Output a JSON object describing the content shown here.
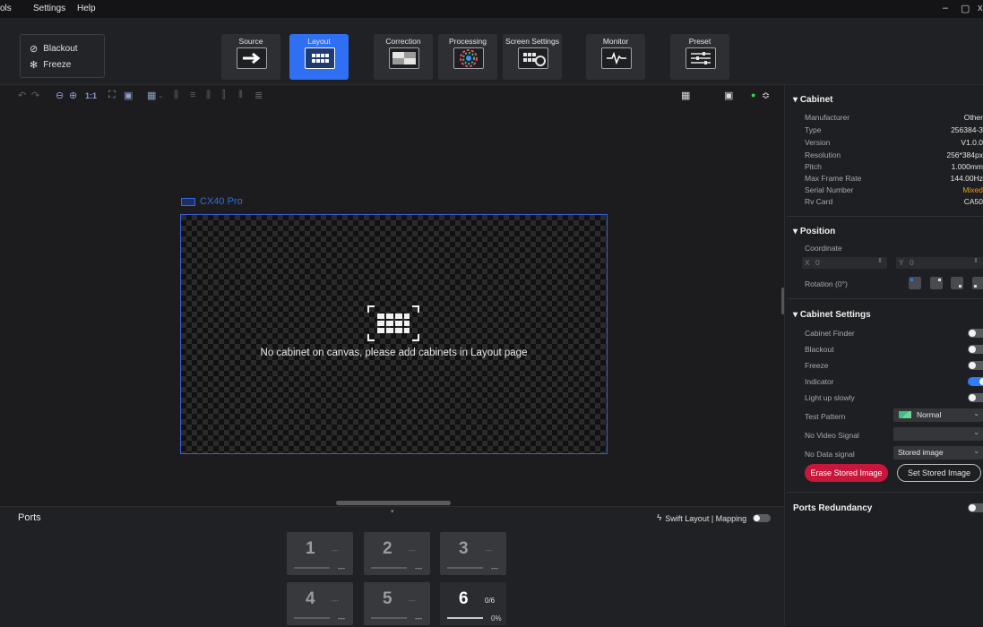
{
  "menu": {
    "tools": "ols",
    "settings": "Settings",
    "help": "Help"
  },
  "window_controls": {
    "minimize": "–",
    "restore": "▢",
    "close": "x"
  },
  "quick_actions": {
    "blackout": "Blackout",
    "freeze": "Freeze"
  },
  "toolbar": [
    {
      "id": "source",
      "label": "Source",
      "icon": "arrow-right-icon"
    },
    {
      "id": "layout",
      "label": "Layout",
      "icon": "grid-icon",
      "active": true
    },
    {
      "id": "correction",
      "label": "Correction",
      "icon": "correction-icon"
    },
    {
      "id": "processing",
      "label": "Processing",
      "icon": "color-wheel-icon"
    },
    {
      "id": "screen_settings",
      "label": "Screen Settings",
      "icon": "screen-settings-icon"
    },
    {
      "id": "monitor",
      "label": "Monitor",
      "icon": "pulse-icon"
    },
    {
      "id": "preset",
      "label": "Preset",
      "icon": "sliders-icon"
    }
  ],
  "canvas_toolbar": {
    "zoom_actual": "1:1"
  },
  "canvas": {
    "cabinet_name": "CX40 Pro",
    "empty_message": "No cabinet on canvas, please add cabinets in Layout page"
  },
  "ports": {
    "title": "Ports",
    "swift_layout": "Swift Layout | Mapping",
    "items": [
      {
        "num": "1",
        "info": "---",
        "pct": "---"
      },
      {
        "num": "2",
        "info": "---",
        "pct": "---"
      },
      {
        "num": "3",
        "info": "---",
        "pct": "---"
      },
      {
        "num": "4",
        "info": "---",
        "pct": "---"
      },
      {
        "num": "5",
        "info": "---",
        "pct": "---"
      },
      {
        "num": "6",
        "info": "0/6",
        "pct": "0%"
      }
    ]
  },
  "cabinet": {
    "title": "Cabinet",
    "props": [
      {
        "label": "Manufacturer",
        "value": "Other"
      },
      {
        "label": "Type",
        "value": "256384-3"
      },
      {
        "label": "Version",
        "value": "V1.0.0"
      },
      {
        "label": "Resolution",
        "value": "256*384px"
      },
      {
        "label": "Pitch",
        "value": "1.000mm"
      },
      {
        "label": "Max Frame Rate",
        "value": "144.00Hz"
      },
      {
        "label": "Serial Number",
        "value": "Mixed"
      },
      {
        "label": "Rv Card",
        "value": "CA50"
      }
    ],
    "mixed_color": "#e0a21c"
  },
  "position": {
    "title": "Position",
    "coordinate": "Coordinate",
    "x_label": "X",
    "x_value": "0",
    "y_label": "Y",
    "y_value": "0",
    "rotation": "Rotation (0°)"
  },
  "cabinet_settings": {
    "title": "Cabinet Settings",
    "toggles": [
      {
        "label": "Cabinet Finder",
        "on": false
      },
      {
        "label": "Blackout",
        "on": false
      },
      {
        "label": "Freeze",
        "on": false
      },
      {
        "label": "Indicator",
        "on": true
      },
      {
        "label": "Light up slowly",
        "on": false
      }
    ],
    "test_pattern_label": "Test Pattern",
    "test_pattern_value": "Normal",
    "no_video_label": "No Video Signal",
    "no_video_value": "",
    "no_data_label": "No Data signal",
    "no_data_value": "Stored image",
    "erase_button": "Erase Stored Image",
    "set_button": "Set Stored Image"
  },
  "ports_redundancy": {
    "title": "Ports Redundancy",
    "on": false
  },
  "colors": {
    "accent": "#2e6ff3",
    "danger": "#c8173b",
    "bg": "#1c1c1e"
  }
}
